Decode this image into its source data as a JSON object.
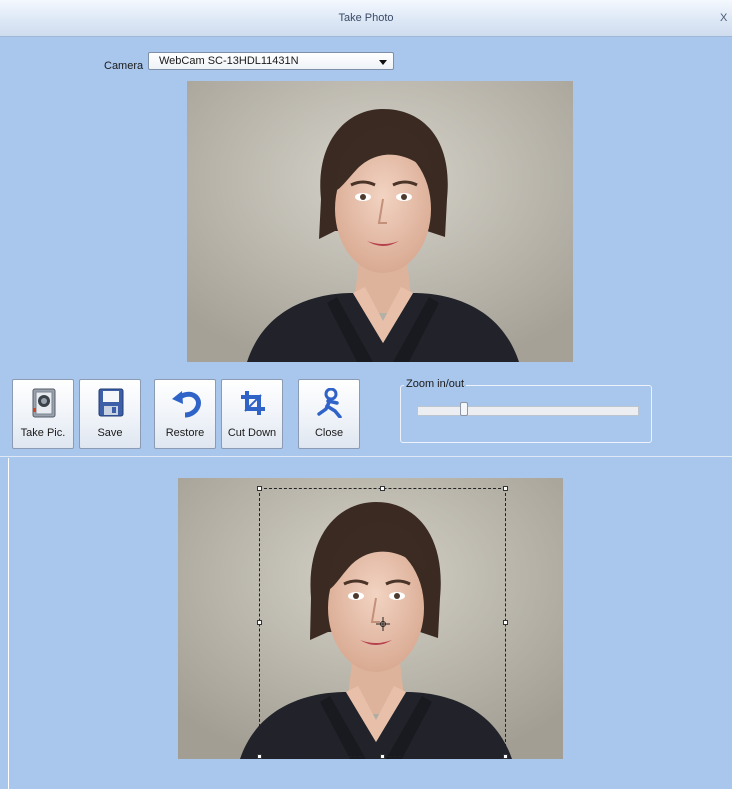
{
  "window": {
    "title": "Take Photo",
    "close_label": "X"
  },
  "camera": {
    "label": "Camera",
    "selected": "WebCam SC-13HDL11431N"
  },
  "toolbar": {
    "take_pic": "Take Pic.",
    "save": "Save",
    "restore": "Restore",
    "cut_down": "Cut Down",
    "close": "Close"
  },
  "zoom": {
    "label": "Zoom in/out",
    "value_fraction": 0.2
  },
  "icons": {
    "take_pic": "camera-icon",
    "save": "floppy-disk-icon",
    "restore": "undo-arrow-icon",
    "cut_down": "crop-icon",
    "close": "person-exit-icon"
  },
  "colors": {
    "window_bg": "#a9c6ec",
    "accent_blue": "#2f63c8"
  }
}
